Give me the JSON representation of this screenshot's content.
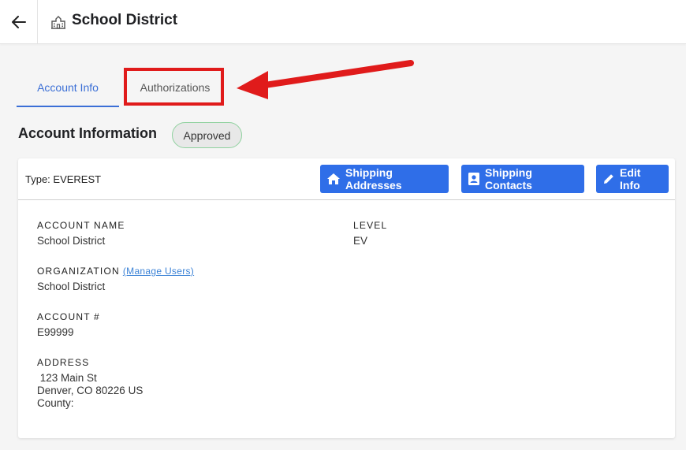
{
  "header": {
    "title": "School District",
    "back_icon": "arrow-left-icon",
    "title_icon": "school-building-icon"
  },
  "tabs": [
    {
      "label": "Account Info",
      "active": true
    },
    {
      "label": "Authorizations",
      "active": false
    }
  ],
  "section": {
    "title": "Account Information",
    "status": "Approved"
  },
  "card": {
    "type_label": "Type: EVEREST",
    "buttons": {
      "shipping_addresses": "Shipping Addresses",
      "shipping_contacts": "Shipping Contacts",
      "edit_info": "Edit Info"
    },
    "fields": {
      "account_name": {
        "label": "ACCOUNT NAME",
        "value": "School District"
      },
      "level": {
        "label": "LEVEL",
        "value": "EV"
      },
      "organization": {
        "label": "ORGANIZATION",
        "link": "(Manage  Users)",
        "value": "School District"
      },
      "account_number": {
        "label": "ACCOUNT #",
        "value": "E99999"
      },
      "address": {
        "label": "ADDRESS",
        "line1": " 123 Main St",
        "line2": "Denver, CO 80226 US",
        "line3": "County:"
      }
    }
  },
  "colors": {
    "accent": "#3b6fd6",
    "button": "#2f6ee8",
    "highlight": "#e01b1b",
    "badge_border": "#8fd19e"
  }
}
